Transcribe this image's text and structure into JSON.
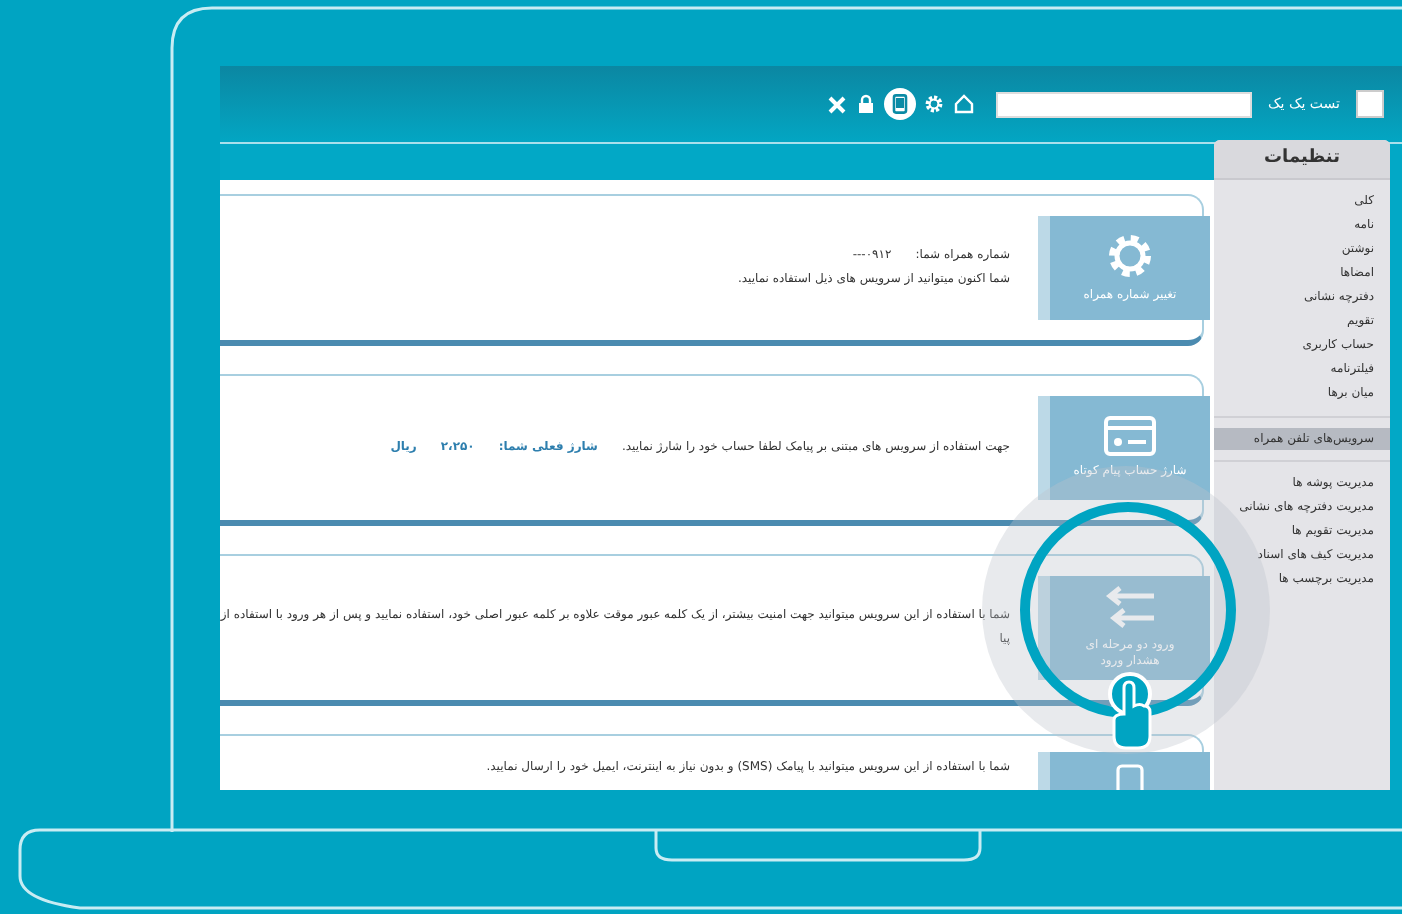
{
  "header": {
    "user_name": "تست یک یک",
    "toolbar_icons": [
      {
        "kind": "home",
        "selected": false
      },
      {
        "kind": "gear",
        "selected": false
      },
      {
        "kind": "phone",
        "selected": true
      },
      {
        "kind": "lock",
        "selected": false
      },
      {
        "kind": "close",
        "selected": false
      }
    ]
  },
  "sidebar": {
    "title": "تنظیمات",
    "groups": [
      {
        "items": [
          {
            "label": "کلی",
            "selected": false
          },
          {
            "label": "نامه",
            "selected": false
          },
          {
            "label": "نوشتن",
            "selected": false
          },
          {
            "label": "امضاها",
            "selected": false
          },
          {
            "label": "دفترچه نشانی",
            "selected": false
          },
          {
            "label": "تقویم",
            "selected": false
          },
          {
            "label": "حساب کاربری",
            "selected": false
          },
          {
            "label": "فیلترنامه",
            "selected": false
          },
          {
            "label": "میان برها",
            "selected": false
          }
        ]
      },
      {
        "items": [
          {
            "label": "سرویس‌های تلفن همراه",
            "selected": true
          }
        ]
      },
      {
        "items": [
          {
            "label": "مدیریت پوشه ها",
            "selected": false
          },
          {
            "label": "مدیریت دفترچه های نشانی",
            "selected": false
          },
          {
            "label": "مدیریت تقویم ها",
            "selected": false
          },
          {
            "label": "مدیریت کیف های اسناد",
            "selected": false
          },
          {
            "label": "مدیریت برچسب ها",
            "selected": false
          }
        ]
      }
    ]
  },
  "cards": [
    {
      "kind": "gear",
      "tile_label": [
        "تغییر شماره همراه"
      ],
      "lines": [
        [
          {
            "kind": "plain",
            "text": "شماره همراه شما:"
          },
          {
            "kind": "plain",
            "text": "۰۹۱۲---"
          }
        ],
        [
          {
            "kind": "plain",
            "text": "شما اکنون میتوانید از سرویس های ذیل استفاده نمایید."
          }
        ]
      ]
    },
    {
      "kind": "card",
      "tile_label": [
        "شارژ حساب پیام کوتاه"
      ],
      "lines": [
        [
          {
            "kind": "plain",
            "text": "جهت استفاده از سرویس های مبتنی بر پیامک لطفا حساب خود را شارژ نمایید."
          },
          {
            "kind": "accent",
            "text": "شارژ فعلی شما:"
          },
          {
            "kind": "accent",
            "text": "۲،۲۵۰"
          },
          {
            "kind": "accent",
            "text": "ریال"
          }
        ]
      ]
    },
    {
      "kind": "arrows",
      "tile_label": [
        "ورود دو مرحله ای",
        "هشدار ورود"
      ],
      "lines": [
        [
          {
            "kind": "plain",
            "text": "شما با استفاده از این سرویس میتوانید جهت امنیت بیشتر، از یک کلمه عبور موقت علاوه بر کلمه عبور اصلی خود، استفاده نمایید و پس از هر ورود با استفاده از پیا"
          }
        ]
      ]
    },
    {
      "kind": "phone",
      "lines": [
        [
          {
            "kind": "plain",
            "text": "شما با استفاده از این سرویس میتوانید با پیامک (SMS) و بدون نیاز به اینترنت، ایمیل خود را ارسال نمایید."
          }
        ]
      ]
    }
  ]
}
